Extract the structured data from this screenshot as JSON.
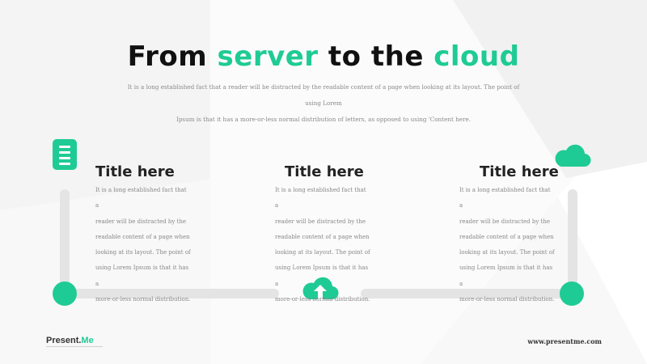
{
  "header": {
    "title_part1": "From ",
    "title_part2": "server",
    "title_part3": " to the ",
    "title_part4": "cloud",
    "subtitle_line1": "It is a long established fact that a reader will be distracted by the readable content of a page when looking at its layout. The point of using Lorem",
    "subtitle_line2": "Ipsum is that it has a more-or-less normal distribution of letters, as opposed to using 'Content here."
  },
  "columns": [
    {
      "title": "Title here",
      "lines": [
        "It is a long established fact that a",
        "reader will be distracted by the",
        "readable content of a page when",
        "looking at its layout. The point of",
        "using Lorem Ipsum is that it has a",
        "more-or-less normal distribution."
      ],
      "icon": "document-icon"
    },
    {
      "title": "Title here",
      "lines": [
        "It is a long established fact that a",
        "reader will be distracted by the",
        "readable content of a page when",
        "looking at its layout. The point of",
        "using Lorem Ipsum is that it has a",
        "more-or-less normal distribution."
      ],
      "icon": "cloud-upload-icon"
    },
    {
      "title": "Title here",
      "lines": [
        "It is a long established fact that a",
        "reader will be distracted by the",
        "readable content of a page when",
        "looking at its layout. The point of",
        "using Lorem Ipsum is that it has a",
        "more-or-less normal distribution."
      ],
      "icon": "cloud-icon"
    }
  ],
  "footer": {
    "brand_part1": "Present.",
    "brand_part2": "Me",
    "url": "www.presentme.com"
  },
  "colors": {
    "accent": "#1fcb94",
    "track": "#e4e4e4",
    "text_dark": "#111111",
    "text_muted": "#888888"
  }
}
